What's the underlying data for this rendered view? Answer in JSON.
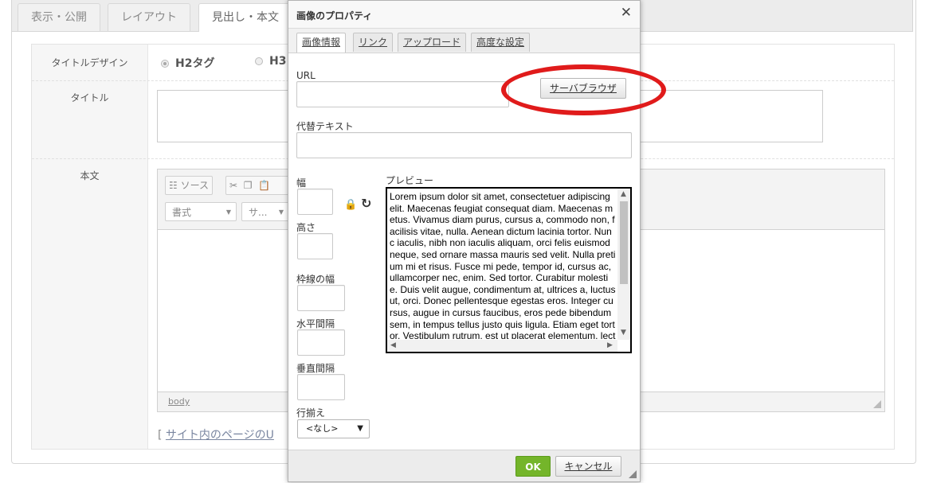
{
  "page_tabs": [
    "表示・公開",
    "レイアウト",
    "見出し・本文"
  ],
  "form": {
    "title_design_label": "タイトルデザイン",
    "radio_h2": "H2タグ",
    "radio_h3": "H3",
    "title_label": "タイトル",
    "body_label": "本文",
    "toolbar": {
      "source_label": "ソース",
      "format_combo": "書式",
      "size_combo": "サ..."
    },
    "status_path": "body",
    "site_link_bracket": "[",
    "site_link_text": "サイト内のページのU"
  },
  "dialog": {
    "title": "画像のプロパティ",
    "close_glyph": "✕",
    "tabs": [
      "画像情報",
      "リンク",
      "アップロード",
      "高度な設定"
    ],
    "url_label": "URL",
    "url_value": "",
    "browse_button": "サーバブラウザ",
    "alt_label": "代替テキスト",
    "alt_value": "",
    "width_label": "幅",
    "height_label": "高さ",
    "border_label": "枠線の幅",
    "hspace_label": "水平間隔",
    "vspace_label": "垂直間隔",
    "align_label": "行揃え",
    "align_value": "<なし>",
    "preview_label": "プレビュー",
    "preview_text": "Lorem ipsum dolor sit amet, consectetuer adipiscing elit. Maecenas feugiat consequat diam. Maecenas metus. Vivamus diam purus, cursus a, commodo non, facilisis vitae, nulla. Aenean dictum lacinia tortor. Nunc iaculis, nibh non iaculis aliquam, orci felis euismod neque, sed ornare massa mauris sed velit. Nulla pretium mi et risus. Fusce mi pede, tempor id, cursus ac, ullamcorper nec, enim. Sed tortor. Curabitur molestie. Duis velit augue, condimentum at, ultrices a, luctus ut, orci. Donec pellentesque egestas eros. Integer cursus, augue in cursus faucibus, eros pede bibendum sem, in tempus tellus justo quis ligula. Etiam eget tortor. Vestibulum rutrum, est ut placerat elementum, lectus nisl aliquam velit, tempor aliquam eros nunc",
    "ok_button": "OK",
    "cancel_button": "キャンセル"
  },
  "colors": {
    "highlight_ellipse": "#e01b1b",
    "ok_green": "#74b52a"
  },
  "icons": {
    "lock": "lock-icon",
    "reset": "reset-size-icon",
    "close": "close-icon"
  }
}
